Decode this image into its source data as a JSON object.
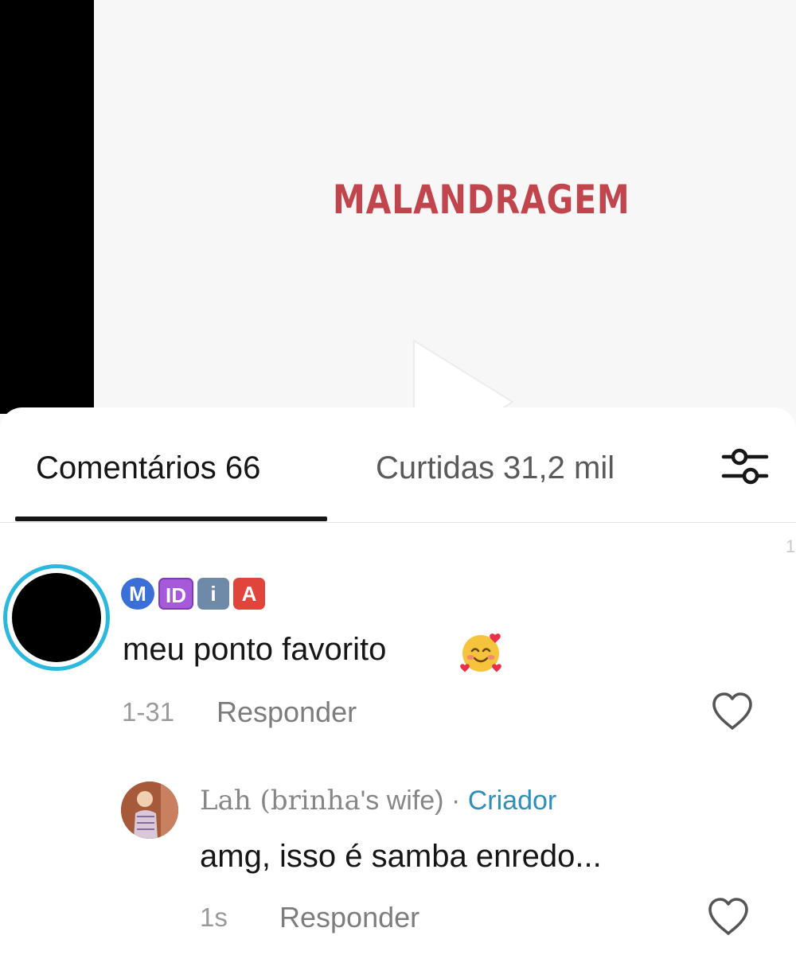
{
  "video": {
    "title": "MALANDRAGEM",
    "play_icon": "play-icon"
  },
  "tabs": {
    "comments_label": "Comentários 66",
    "likes_label": "Curtidas 31,2 mil",
    "filter_icon": "sliders-icon"
  },
  "edge_fragment": "1",
  "comments": [
    {
      "username_badges": [
        "M",
        "ID",
        "i",
        "A"
      ],
      "text": "meu ponto favorito",
      "emoji": "smiling-face-with-hearts",
      "date": "1-31",
      "reply_label": "Responder",
      "like_icon": "heart-outline-icon"
    }
  ],
  "reply": {
    "name_styled": "Lah (brinha",
    "name_rest": "'s wife)",
    "separator": "·",
    "creator_label": "Criador",
    "text": "amg, isso é samba enredo...",
    "date": "1s",
    "reply_label": "Responder",
    "like_icon": "heart-outline-icon"
  },
  "colors": {
    "title": "#c0454d",
    "creator": "#2f8fb8",
    "avatar_ring": "#2bb8df"
  }
}
